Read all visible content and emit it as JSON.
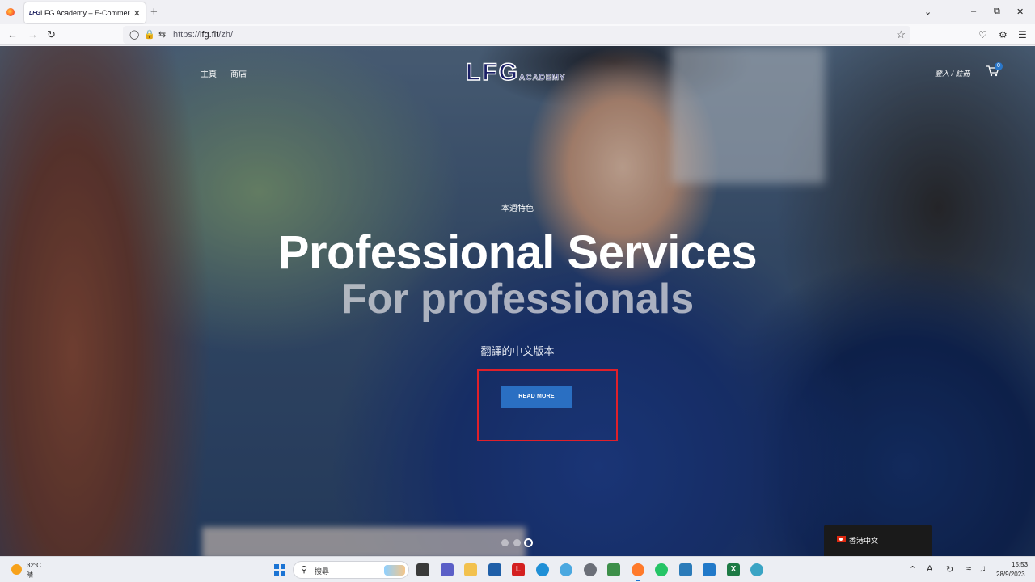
{
  "browser": {
    "tab_title": "LFG Academy – E-Commerce",
    "tab_favicon_text": "LFG",
    "tab_close": "✕",
    "new_tab": "+",
    "url_prefix": "https://",
    "url_host": "lfg.fit",
    "url_path": "/zh/"
  },
  "site": {
    "nav": [
      "主頁",
      "商店"
    ],
    "logo_main": "LFG",
    "logo_sub": "ACADEMY",
    "login": "登入 / 註冊",
    "cart_count": "0"
  },
  "hero": {
    "eyebrow": "本週特色",
    "headline": "Professional Services",
    "subhead": "For professionals",
    "description": "翻譯的中文版本",
    "button_label": "READ MORE",
    "slides_total": 3,
    "slide_active": 3
  },
  "language_popup": {
    "label": "香港中文"
  },
  "taskbar": {
    "temperature": "32°C",
    "condition": "晴",
    "search_placeholder": "搜尋",
    "time": "15:53",
    "date": "28/9/2023"
  },
  "colors": {
    "accent_button": "#2a6fc2",
    "highlight_box": "#e0202a",
    "logo_navy": "#1a1f66"
  }
}
